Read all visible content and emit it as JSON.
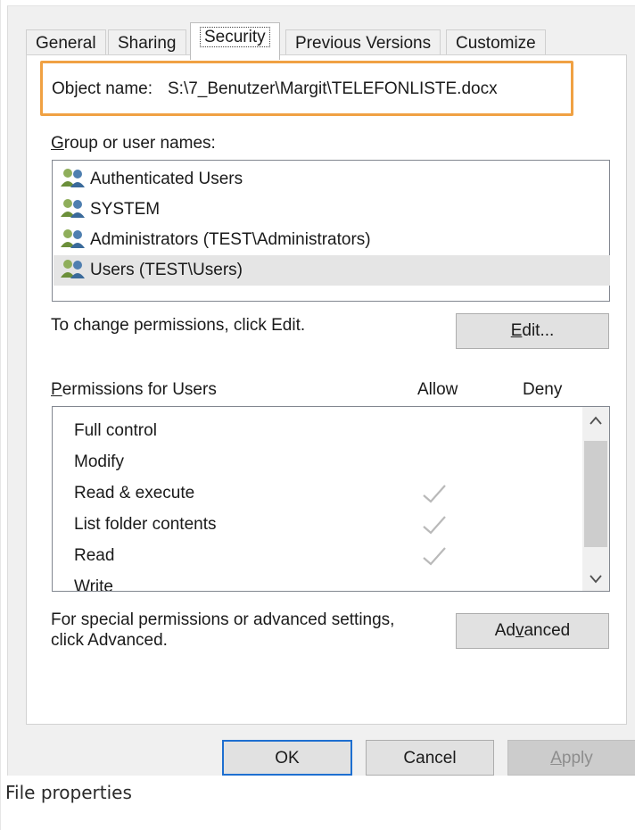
{
  "tabs": [
    {
      "label": "General",
      "active": false
    },
    {
      "label": "Sharing",
      "active": false
    },
    {
      "label": "Security",
      "active": true
    },
    {
      "label": "Previous Versions",
      "active": false
    },
    {
      "label": "Customize",
      "active": false
    }
  ],
  "object": {
    "label": "Object name:",
    "value": "S:\\7_Benutzer\\Margit\\TELEFONLISTE.docx",
    "highlight_color": "#f0a143"
  },
  "groups": {
    "label_prefix": "G",
    "label_rest": "roup or user names:",
    "items": [
      {
        "name": "Authenticated Users",
        "selected": false
      },
      {
        "name": "SYSTEM",
        "selected": false
      },
      {
        "name": "Administrators (TEST\\Administrators)",
        "selected": false
      },
      {
        "name": "Users (TEST\\Users)",
        "selected": true
      }
    ],
    "icon": "users-group-icon"
  },
  "change_hint": "To change permissions, click Edit.",
  "edit_button": {
    "pre": "",
    "accel": "E",
    "post": "dit..."
  },
  "permissions": {
    "label_accel": "P",
    "label_rest": "ermissions for Users",
    "allow_header": "Allow",
    "deny_header": "Deny",
    "rows": [
      {
        "name": "Full control",
        "allow": false,
        "deny": false
      },
      {
        "name": "Modify",
        "allow": false,
        "deny": false
      },
      {
        "name": "Read & execute",
        "allow": true,
        "deny": false
      },
      {
        "name": "List folder contents",
        "allow": true,
        "deny": false
      },
      {
        "name": "Read",
        "allow": true,
        "deny": false
      },
      {
        "name": "Write",
        "allow": false,
        "deny": false
      }
    ]
  },
  "advanced_hint_line1": "For special permissions or advanced settings,",
  "advanced_hint_line2": "click Advanced.",
  "advanced_button": {
    "pre": "Ad",
    "accel": "v",
    "post": "anced"
  },
  "footer": {
    "ok": "OK",
    "cancel": "Cancel",
    "apply_accel": "A",
    "apply_rest": "pply"
  },
  "caption": "File properties",
  "colors": {
    "focus_border": "#1e6fd0",
    "selection": "#e5e5e5",
    "check": "#b9b9b9"
  }
}
